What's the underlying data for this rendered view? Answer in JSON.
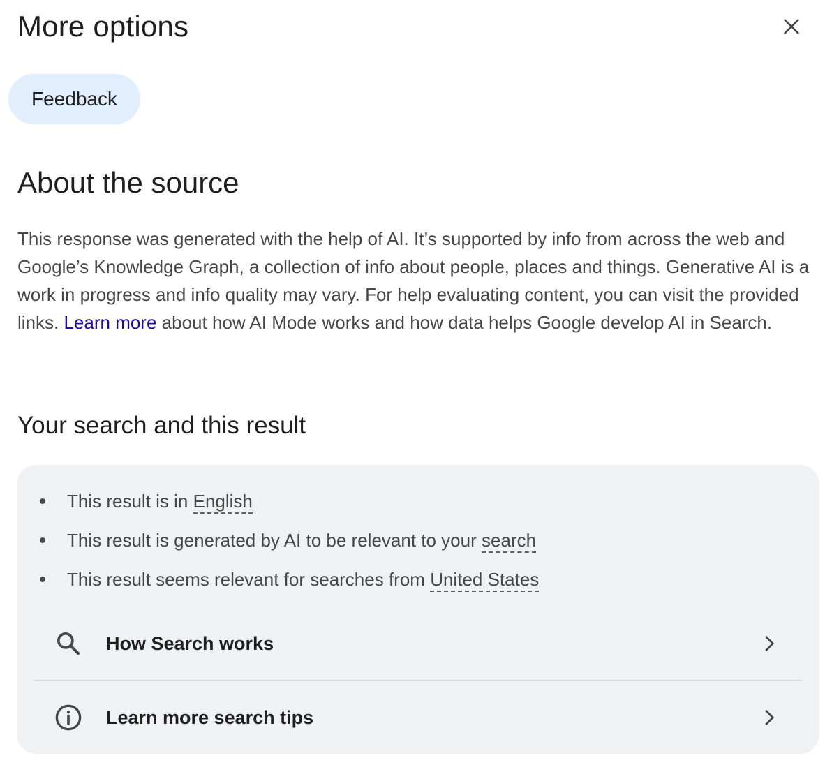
{
  "header": {
    "title": "More options",
    "close_icon": "close-icon"
  },
  "feedback": {
    "label": "Feedback"
  },
  "about": {
    "heading": "About the source",
    "text_before_link": "This response was generated with the help of AI. It’s supported by info from across the web and Google’s Knowledge Graph, a collection of info about people, places and things. Generative AI is a work in progress and info quality may vary. For help evaluating content, you can visit the provided links. ",
    "link_text": "Learn more",
    "text_after_link": " about how AI Mode works and how data helps Google develop AI in Search."
  },
  "search_result": {
    "heading": "Your search and this result",
    "bullets": [
      {
        "prefix": "This result is in ",
        "term": "English"
      },
      {
        "prefix": "This result is generated by AI to be relevant to your ",
        "term": "search"
      },
      {
        "prefix": "This result seems relevant for searches from ",
        "term": "United States"
      }
    ],
    "links": [
      {
        "label": "How Search works",
        "icon": "search-icon"
      },
      {
        "label": "Learn more search tips",
        "icon": "info-icon"
      }
    ]
  },
  "colors": {
    "feedback_bg": "#e1eefd",
    "card_bg": "#f0f1f3",
    "link": "#1a0dab",
    "body_text": "#474747",
    "heading_text": "#1f1f1f"
  }
}
